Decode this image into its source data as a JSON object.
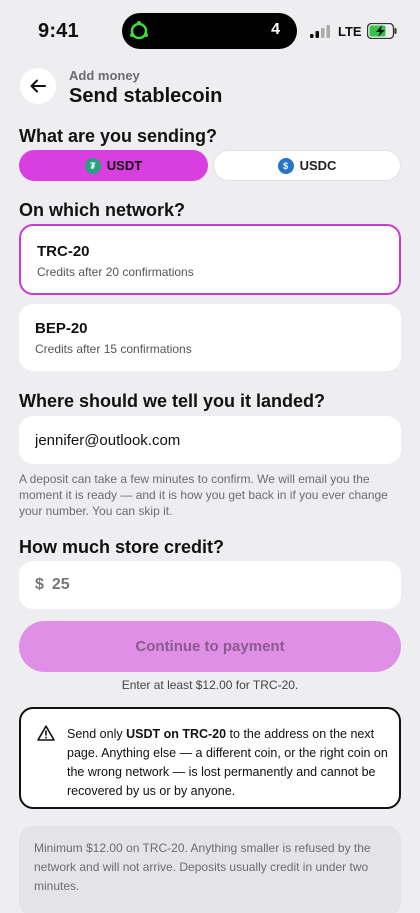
{
  "status_bar": {
    "time": "9:41",
    "island_count": "4",
    "network": "LTE"
  },
  "header": {
    "eyebrow": "Add money",
    "title": "Send stablecoin"
  },
  "coin_section": {
    "title": "What are you sending?",
    "options": [
      {
        "label": "USDT",
        "selected": true,
        "color": "#26a17b"
      },
      {
        "label": "USDC",
        "selected": false,
        "color": "#2775ca"
      }
    ],
    "accent": "#d83ee0"
  },
  "network_section": {
    "title": "On which network?",
    "options": [
      {
        "name": "TRC-20",
        "subtitle": "Credits after 20 confirmations",
        "selected": true
      },
      {
        "name": "BEP-20",
        "subtitle": "Credits after 15 confirmations",
        "selected": false
      }
    ]
  },
  "email_section": {
    "title": "Where should we tell you it landed?",
    "value": "jennifer@outlook.com",
    "helper": "A deposit can take a few minutes to confirm. We will email you the moment it is ready — and it is how you get back in if you ever change your number. You can skip it."
  },
  "amount_section": {
    "title": "How much store credit?",
    "currency": "$",
    "placeholder": "25"
  },
  "cta": {
    "label": "Continue to payment",
    "hint": "Enter at least $12.00 for TRC-20."
  },
  "warning": {
    "prefix": "Send only ",
    "bold": "USDT on TRC-20",
    "suffix": " to the address on the next page. Anything else — a different coin, or the right coin on the wrong network — is lost permanently and cannot be recovered by us or by anyone."
  },
  "note": "Minimum $12.00 on TRC-20. Anything smaller is refused by the network and will not arrive. Deposits usually credit in under two minutes."
}
